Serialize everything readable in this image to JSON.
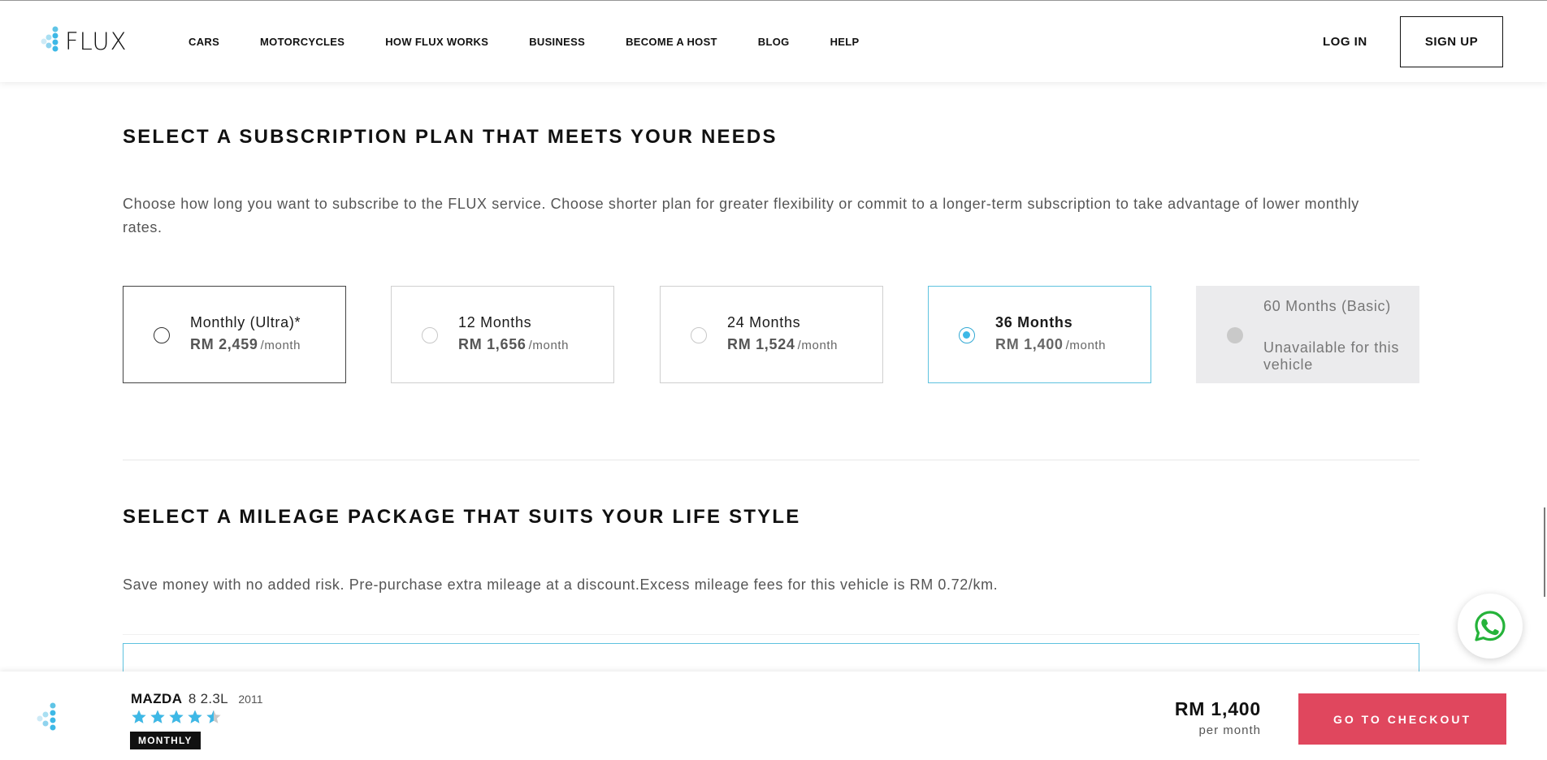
{
  "brand": {
    "name": "FLUX",
    "logo_icon": "flux-logo-icon",
    "accent_color": "#3db8e6",
    "cta_color": "#e0475e"
  },
  "nav": {
    "items": [
      {
        "label": "CARS"
      },
      {
        "label": "MOTORCYCLES"
      },
      {
        "label": "HOW FLUX WORKS"
      },
      {
        "label": "BUSINESS"
      },
      {
        "label": "BECOME A HOST"
      },
      {
        "label": "BLOG"
      },
      {
        "label": "HELP"
      }
    ],
    "login_label": "LOG IN",
    "signup_label": "SIGN UP"
  },
  "subscription": {
    "title": "SELECT A SUBSCRIPTION PLAN THAT MEETS YOUR NEEDS",
    "description": "Choose how long you want to subscribe to the FLUX service. Choose shorter plan for greater flexibility or commit to a longer-term subscription to take advantage of lower monthly rates.",
    "plans": [
      {
        "name": "Monthly (Ultra)*",
        "price": "RM 2,459",
        "unit": "/month",
        "selected": false
      },
      {
        "name": "12 Months",
        "price": "RM 1,656",
        "unit": "/month",
        "selected": false
      },
      {
        "name": "24 Months",
        "price": "RM 1,524",
        "unit": "/month",
        "selected": false
      },
      {
        "name": "36 Months",
        "price": "RM 1,400",
        "unit": "/month",
        "selected": true
      },
      {
        "name": "60 Months (Basic)",
        "note": "Unavailable for this vehicle",
        "disabled": true
      }
    ]
  },
  "mileage": {
    "title": "SELECT A MILEAGE PACKAGE THAT SUITS YOUR LIFE STYLE",
    "description": "Save money with no added risk. Pre-purchase extra mileage at a discount.Excess mileage fees for this vehicle is RM 0.72/km."
  },
  "whatsapp": {
    "icon": "whatsapp-icon"
  },
  "bottom_bar": {
    "car_make": "MAZDA",
    "car_model": "8 2.3L",
    "car_year": "2011",
    "rating": 4.5,
    "rating_max": 5,
    "plan_badge": "MONTHLY",
    "price": "RM 1,400",
    "price_unit": "per month",
    "checkout_label": "GO TO CHECKOUT"
  }
}
